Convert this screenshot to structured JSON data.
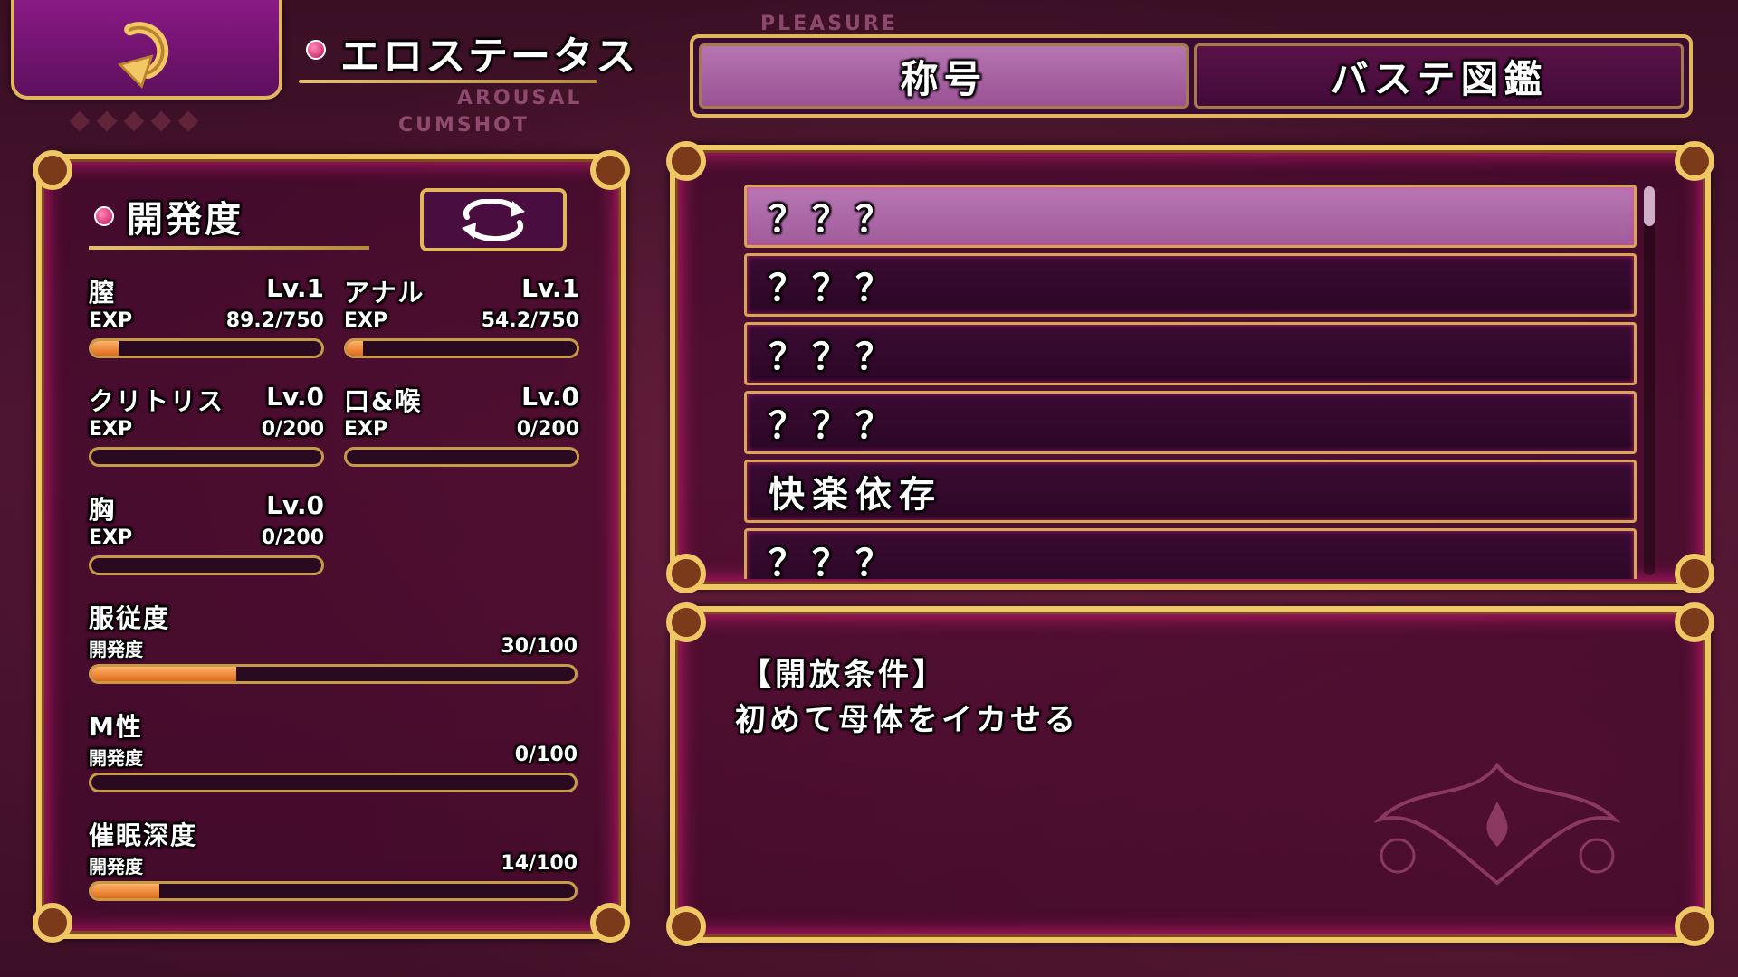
{
  "header": {
    "back_icon": "return-arrow-icon",
    "title": "エロステータス",
    "ghost_labels": [
      "AROUSAL",
      "CUMSHOT",
      "PLEASURE"
    ]
  },
  "tabs": [
    {
      "label": "称号",
      "active": true
    },
    {
      "label": "バステ図鑑",
      "active": false
    }
  ],
  "left": {
    "section_title": "開発度",
    "cycle_icon": "cycle-arrows-icon",
    "stats": [
      {
        "name": "膣",
        "level": "Lv.1",
        "exp_label": "EXP",
        "exp": "89.2/750",
        "fill": 0.119
      },
      {
        "name": "アナル",
        "level": "Lv.1",
        "exp_label": "EXP",
        "exp": "54.2/750",
        "fill": 0.072
      },
      {
        "name": "クリトリス",
        "level": "Lv.0",
        "exp_label": "EXP",
        "exp": "0/200",
        "fill": 0
      },
      {
        "name": "口&喉",
        "level": "Lv.0",
        "exp_label": "EXP",
        "exp": "0/200",
        "fill": 0
      },
      {
        "name": "胸",
        "level": "Lv.0",
        "exp_label": "EXP",
        "exp": "0/200",
        "fill": 0
      }
    ],
    "meters": [
      {
        "name": "服従度",
        "sub_label": "開発度",
        "value": "30/100",
        "fill": 0.3
      },
      {
        "name": "M性",
        "sub_label": "開発度",
        "value": "0/100",
        "fill": 0
      },
      {
        "name": "催眠深度",
        "sub_label": "開発度",
        "value": "14/100",
        "fill": 0.14
      }
    ]
  },
  "list": {
    "items": [
      "？？？",
      "？？？",
      "？？？",
      "？？？",
      "快楽依存",
      "？？？"
    ],
    "selected_index": 0
  },
  "detail": {
    "condition_label": "【開放条件】",
    "condition_text": "初めて母体をイカせる"
  },
  "colors": {
    "gold": "#f0c765",
    "neon_pink": "#ff1e8c",
    "bar_fill": "#e06a1c",
    "selected": "#a05b9b"
  }
}
